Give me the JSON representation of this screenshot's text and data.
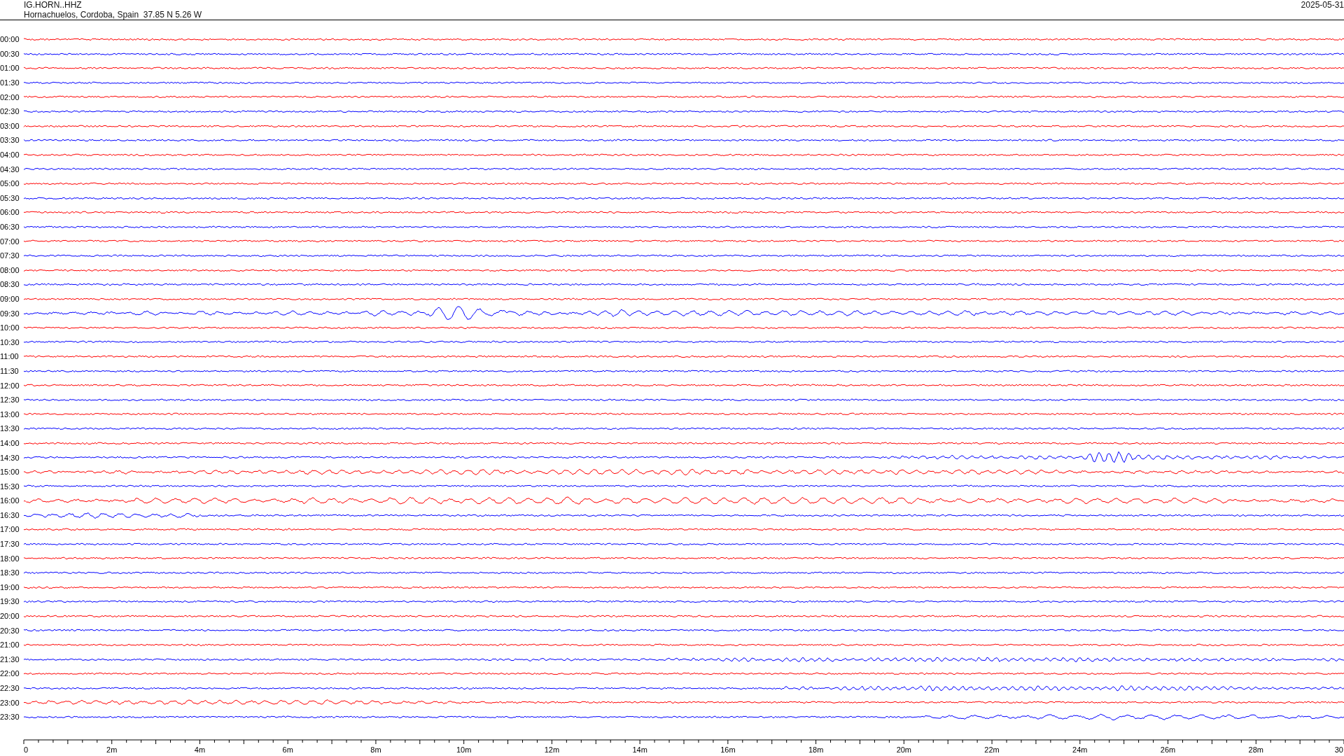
{
  "header": {
    "station": "IG.HORN..HHZ",
    "location": "Hornachuelos, Cordoba, Spain  37.85 N 5.26 W",
    "date": "2025-05-31"
  },
  "rows": [
    {
      "time": "00:00",
      "color": "#ff0000"
    },
    {
      "time": "00:30",
      "color": "#0000ff"
    },
    {
      "time": "01:00",
      "color": "#ff0000"
    },
    {
      "time": "01:30",
      "color": "#0000ff"
    },
    {
      "time": "02:00",
      "color": "#ff0000"
    },
    {
      "time": "02:30",
      "color": "#0000ff"
    },
    {
      "time": "03:00",
      "color": "#ff0000"
    },
    {
      "time": "03:30",
      "color": "#0000ff"
    },
    {
      "time": "04:00",
      "color": "#ff0000"
    },
    {
      "time": "04:30",
      "color": "#0000ff"
    },
    {
      "time": "05:00",
      "color": "#ff0000"
    },
    {
      "time": "05:30",
      "color": "#0000ff"
    },
    {
      "time": "06:00",
      "color": "#ff0000"
    },
    {
      "time": "06:30",
      "color": "#0000ff"
    },
    {
      "time": "07:00",
      "color": "#ff0000"
    },
    {
      "time": "07:30",
      "color": "#0000ff"
    },
    {
      "time": "08:00",
      "color": "#ff0000"
    },
    {
      "time": "08:30",
      "color": "#0000ff"
    },
    {
      "time": "09:00",
      "color": "#ff0000"
    },
    {
      "time": "09:30",
      "color": "#0000ff"
    },
    {
      "time": "10:00",
      "color": "#ff0000"
    },
    {
      "time": "10:30",
      "color": "#0000ff"
    },
    {
      "time": "11:00",
      "color": "#ff0000"
    },
    {
      "time": "11:30",
      "color": "#0000ff"
    },
    {
      "time": "12:00",
      "color": "#ff0000"
    },
    {
      "time": "12:30",
      "color": "#0000ff"
    },
    {
      "time": "13:00",
      "color": "#ff0000"
    },
    {
      "time": "13:30",
      "color": "#0000ff"
    },
    {
      "time": "14:00",
      "color": "#ff0000"
    },
    {
      "time": "14:30",
      "color": "#0000ff"
    },
    {
      "time": "15:00",
      "color": "#ff0000"
    },
    {
      "time": "15:30",
      "color": "#0000ff"
    },
    {
      "time": "16:00",
      "color": "#ff0000"
    },
    {
      "time": "16:30",
      "color": "#0000ff"
    },
    {
      "time": "17:00",
      "color": "#ff0000"
    },
    {
      "time": "17:30",
      "color": "#0000ff"
    },
    {
      "time": "18:00",
      "color": "#ff0000"
    },
    {
      "time": "18:30",
      "color": "#0000ff"
    },
    {
      "time": "19:00",
      "color": "#ff0000"
    },
    {
      "time": "19:30",
      "color": "#0000ff"
    },
    {
      "time": "20:00",
      "color": "#ff0000"
    },
    {
      "time": "20:30",
      "color": "#0000ff"
    },
    {
      "time": "21:00",
      "color": "#ff0000"
    },
    {
      "time": "21:30",
      "color": "#0000ff"
    },
    {
      "time": "22:00",
      "color": "#ff0000"
    },
    {
      "time": "22:30",
      "color": "#0000ff"
    },
    {
      "time": "23:00",
      "color": "#ff0000"
    },
    {
      "time": "23:30",
      "color": "#0000ff"
    }
  ],
  "axis": {
    "ticks": [
      "0",
      "2m",
      "4m",
      "6m",
      "8m",
      "10m",
      "12m",
      "14m",
      "16m",
      "18m",
      "20m",
      "22m",
      "24m",
      "26m",
      "28m",
      "30"
    ]
  }
}
